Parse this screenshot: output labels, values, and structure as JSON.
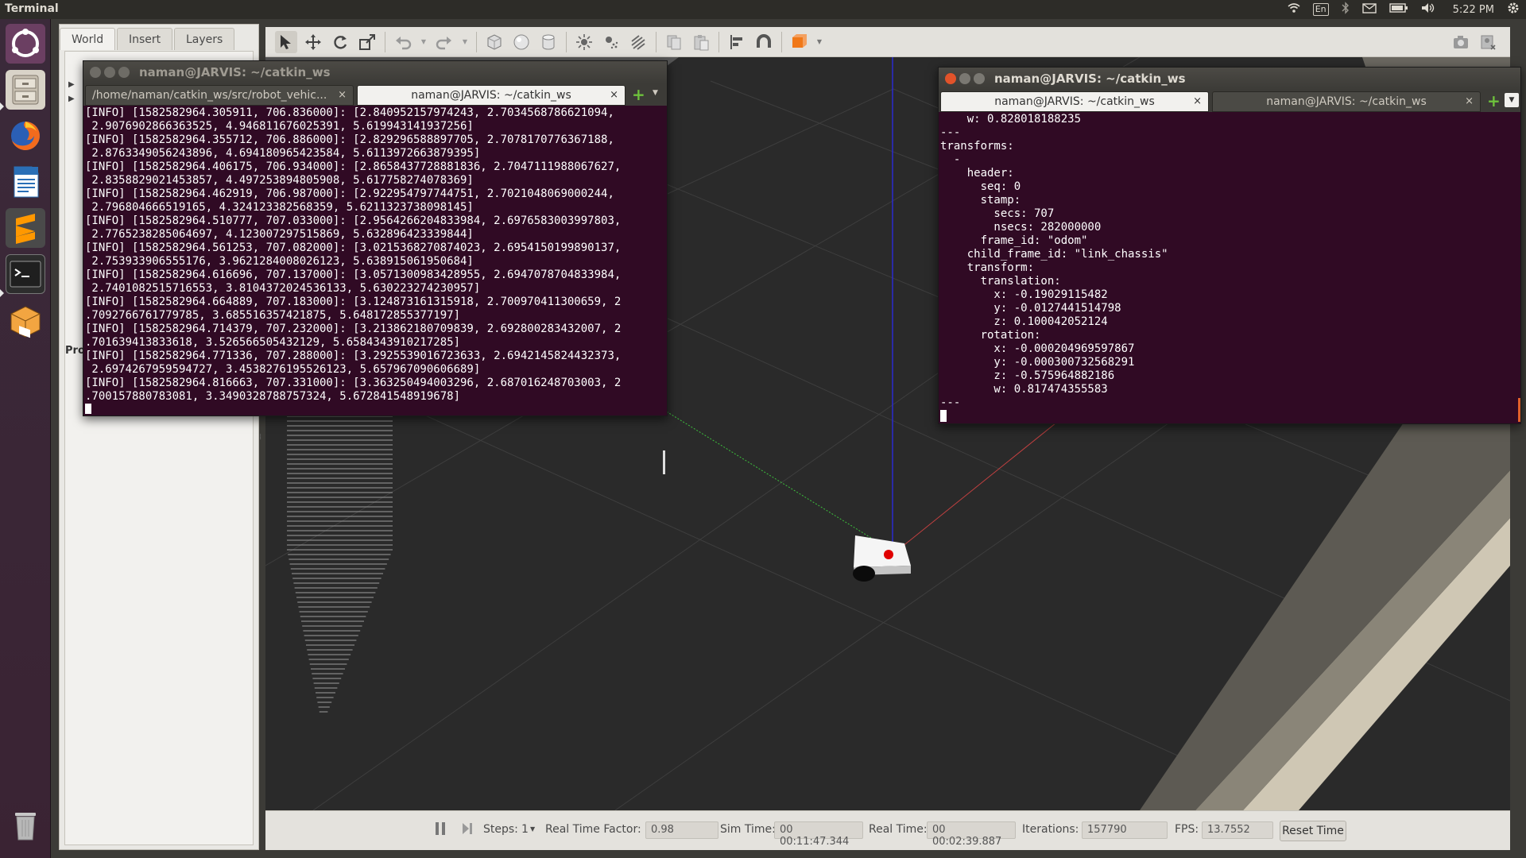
{
  "top_panel": {
    "app_title": "Terminal",
    "keyboard_layout": "En",
    "clock": "5:22 PM",
    "icons": [
      "wifi-icon",
      "keyboard-icon",
      "bluetooth-icon",
      "mail-icon",
      "battery-icon",
      "volume-icon",
      "settings-gear-icon"
    ]
  },
  "launcher": {
    "items": [
      "ubuntu-dash",
      "files",
      "firefox",
      "libreoffice-writer",
      "sublime-text",
      "terminal",
      "virtualbox",
      "trash"
    ]
  },
  "gazebo": {
    "tabs": [
      "World",
      "Insert",
      "Layers"
    ],
    "active_tab": "World",
    "left_panel_partial_label": "Pro",
    "toolbar_icons": [
      "select-arrow-icon",
      "translate-icon",
      "rotate-icon",
      "scale-icon",
      "undo-icon",
      "redo-icon",
      "box-shape-icon",
      "sphere-shape-icon",
      "cylinder-shape-icon",
      "point-light-icon",
      "spot-light-icon",
      "directional-light-icon",
      "copy-icon",
      "paste-icon",
      "align-icon",
      "snap-magnet-icon",
      "view-angle-icon",
      "screenshot-camera-icon",
      "record-icon"
    ],
    "bottom": {
      "steps_label": "Steps:",
      "steps_value": "1",
      "rtf_label": "Real Time Factor:",
      "rtf_value": "0.98",
      "sim_time_label": "Sim Time:",
      "sim_time_value": "00 00:11:47.344",
      "real_time_label": "Real Time:",
      "real_time_value": "00 00:02:39.887",
      "iterations_label": "Iterations:",
      "iterations_value": "157790",
      "fps_label": "FPS:",
      "fps_value": "13.7552",
      "reset_label": "Reset Time"
    }
  },
  "terminal_left": {
    "title": "naman@JARVIS: ~/catkin_ws",
    "tabs": [
      "/home/naman/catkin_ws/src/robot_vehic...",
      "naman@JARVIS: ~/catkin_ws"
    ],
    "active_tab": 1,
    "lines": [
      "[INFO] [1582582964.305911, 706.836000]: [2.840952157974243, 2.7034568786621094,",
      " 2.9076902866363525, 4.946811676025391, 5.619943141937256]",
      "[INFO] [1582582964.355712, 706.886000]: [2.829296588897705, 2.7078170776367188,",
      " 2.8763349056243896, 4.694180965423584, 5.6113972663879395]",
      "[INFO] [1582582964.406175, 706.934000]: [2.8658437728881836, 2.7047111988067627,",
      " 2.8358829021453857, 4.497253894805908, 5.617758274078369]",
      "[INFO] [1582582964.462919, 706.987000]: [2.922954797744751, 2.7021048069000244,",
      " 2.796804666519165, 4.324123382568359, 5.6211323738098145]",
      "[INFO] [1582582964.510777, 707.033000]: [2.9564266204833984, 2.6976583003997803,",
      " 2.7765238285064697, 4.123007297515869, 5.632896423339844]",
      "[INFO] [1582582964.561253, 707.082000]: [3.0215368270874023, 2.6954150199890137,",
      " 2.753933906555176, 3.9621284008026123, 5.638915061950684]",
      "[INFO] [1582582964.616696, 707.137000]: [3.0571300983428955, 2.6947078704833984,",
      " 2.7401082515716553, 3.8104372024536133, 5.630223274230957]",
      "[INFO] [1582582964.664889, 707.183000]: [3.124873161315918, 2.700970411300659, 2",
      ".7092766761779785, 3.685516357421875, 5.648172855377197]",
      "[INFO] [1582582964.714379, 707.232000]: [3.213862180709839, 2.692800283432007, 2",
      ".701639413833618, 3.526566505432129, 5.6584343910217285]",
      "[INFO] [1582582964.771336, 707.288000]: [3.2925539016723633, 2.6942145824432373,",
      " 2.6974267959594727, 3.4538276195526123, 5.657967090606689]",
      "[INFO] [1582582964.816663, 707.331000]: [3.363250494003296, 2.687016248703003, 2",
      ".700157880783081, 3.3490328788757324, 5.672841548919678]"
    ]
  },
  "terminal_right": {
    "title": "naman@JARVIS: ~/catkin_ws",
    "tabs": [
      "naman@JARVIS: ~/catkin_ws",
      "naman@JARVIS: ~/catkin_ws"
    ],
    "active_tab": 0,
    "lines": [
      "    w: 0.828018188235",
      "---",
      "transforms: ",
      "  - ",
      "    header: ",
      "      seq: 0",
      "      stamp: ",
      "        secs: 707",
      "        nsecs: 282000000",
      "      frame_id: \"odom\"",
      "    child_frame_id: \"link_chassis\"",
      "    transform: ",
      "      translation: ",
      "        x: -0.19029115482",
      "        y: -0.0127441514798",
      "        z: 0.100042052124",
      "      rotation: ",
      "        x: -0.000204969597867",
      "        y: -0.000300732568291",
      "        z: -0.575964882186",
      "        w: 0.817474355583",
      "---"
    ]
  },
  "colors": {
    "terminal_bg": "#300a24",
    "viewport_bg": "#2c2c2c",
    "axis_x": "#d04040",
    "axis_y": "#40c040",
    "axis_z": "#3030d0"
  }
}
